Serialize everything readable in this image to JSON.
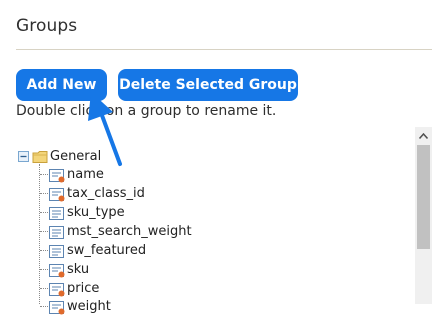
{
  "header": {
    "title": "Groups"
  },
  "toolbar": {
    "add_label": "Add New",
    "delete_label": "Delete Selected Group"
  },
  "hint": "Double click on a group to rename it.",
  "tree": {
    "root": "General",
    "items": [
      {
        "label": "name",
        "type": "user-defined"
      },
      {
        "label": "tax_class_id",
        "type": "user-defined"
      },
      {
        "label": "sku_type",
        "type": "system"
      },
      {
        "label": "mst_search_weight",
        "type": "system"
      },
      {
        "label": "sw_featured",
        "type": "system"
      },
      {
        "label": "sku",
        "type": "user-defined"
      },
      {
        "label": "price",
        "type": "user-defined"
      },
      {
        "label": "weight",
        "type": "user-defined"
      }
    ]
  },
  "colors": {
    "button_bg": "#1677e6",
    "arrow": "#1677e6",
    "divider": "#d8d3c4"
  },
  "icons": {
    "root_toggle": "minus-toggle-icon",
    "root_folder": "folder-icon",
    "attribute": "attribute-icon"
  }
}
